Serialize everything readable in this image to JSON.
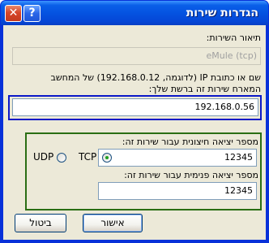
{
  "window": {
    "title": "הגדרות שירות",
    "help_glyph": "?",
    "close_glyph": "✕"
  },
  "description": {
    "label": "תיאור השירות:",
    "value": "eMule (tcp)"
  },
  "host": {
    "label_line1": "שם או כתובת IP (לדוגמה, 192.168.0.12) של המחשב",
    "label_line2": "המארח שירות זה ברשת שלך:",
    "value": "192.168.0.56"
  },
  "external_port": {
    "label": "מספר יציאה חיצונית עבור שירות זה:",
    "value": "12345"
  },
  "internal_port": {
    "label": "מספר יציאה פנימית עבור שירות זה:",
    "value": "12345"
  },
  "protocol": {
    "options": [
      "TCP",
      "UDP"
    ],
    "selected": "TCP"
  },
  "buttons": {
    "ok": "אישור",
    "cancel": "ביטול"
  }
}
